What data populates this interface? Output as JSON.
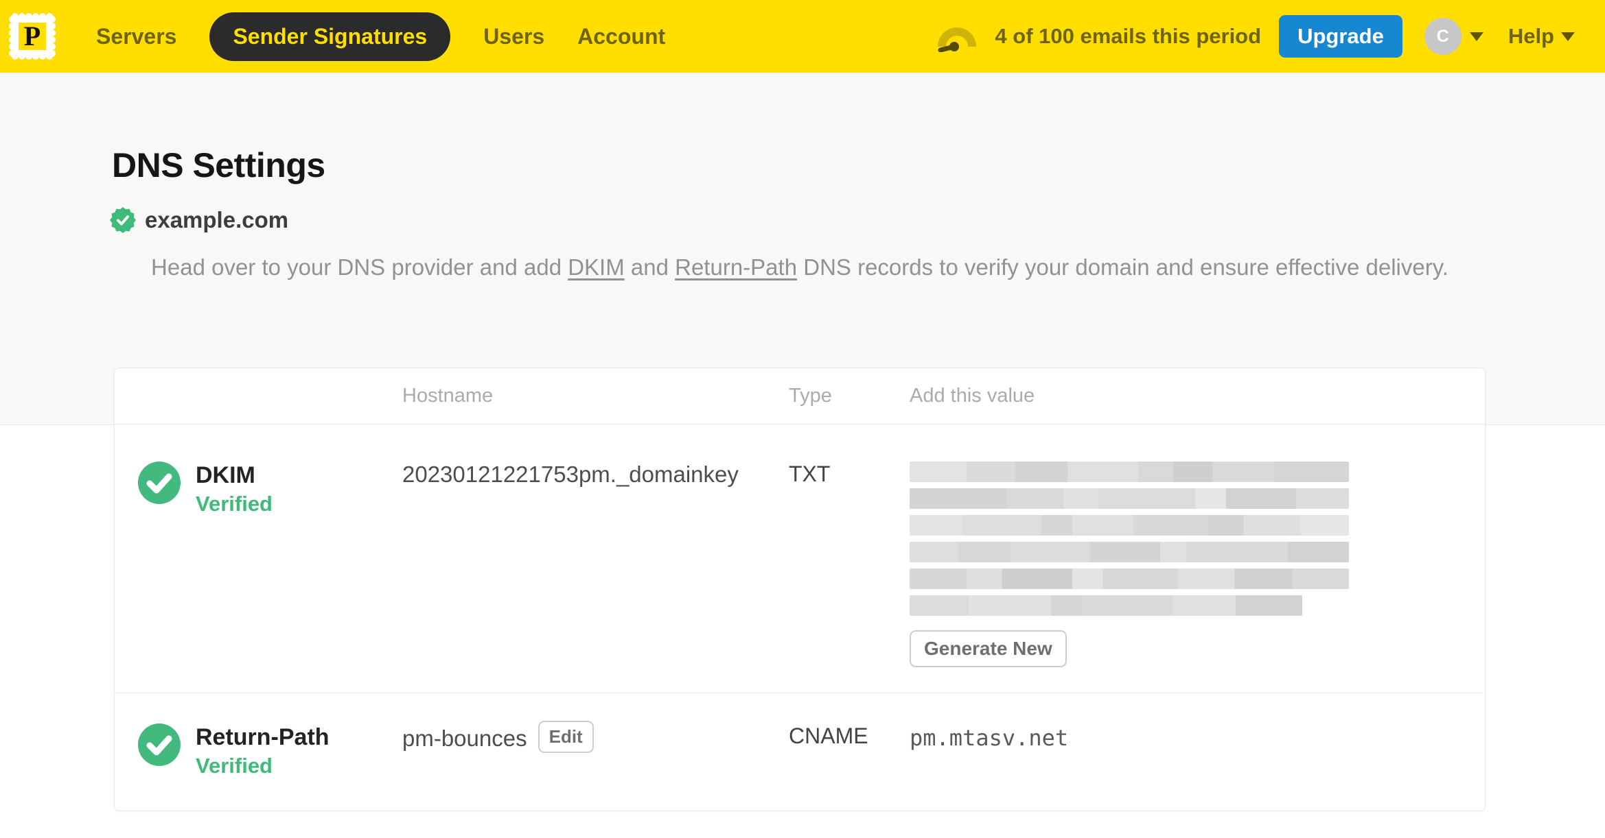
{
  "nav": {
    "logo_letter": "P",
    "items": [
      {
        "label": "Servers",
        "active": false
      },
      {
        "label": "Sender Signatures",
        "active": true
      },
      {
        "label": "Users",
        "active": false
      },
      {
        "label": "Account",
        "active": false
      }
    ],
    "usage_text": "4 of 100 emails this period",
    "upgrade_label": "Upgrade",
    "avatar_initial": "C",
    "help_label": "Help"
  },
  "page": {
    "title": "DNS Settings",
    "domain": "example.com",
    "description": {
      "p1": "Head over to your DNS provider and add ",
      "link1": "DKIM",
      "p2": " and ",
      "link2": "Return-Path",
      "p3": " DNS records to verify your domain and ensure effective delivery."
    }
  },
  "table": {
    "headers": [
      "Hostname",
      "Type",
      "Add this value"
    ],
    "rows": [
      {
        "name": "DKIM",
        "status": "Verified",
        "hostname": "20230121221753pm._domainkey",
        "type": "TXT",
        "value_redacted": true,
        "action_label": "Generate New"
      },
      {
        "name": "Return-Path",
        "status": "Verified",
        "hostname": "pm-bounces",
        "hostname_action_label": "Edit",
        "type": "CNAME",
        "value": "pm.mtasv.net"
      }
    ]
  },
  "colors": {
    "brand_yellow": "#ffde00",
    "nav_pill_dark": "#2b2b2b",
    "upgrade_blue": "#1787d1",
    "verified_green": "#3eba7a"
  }
}
